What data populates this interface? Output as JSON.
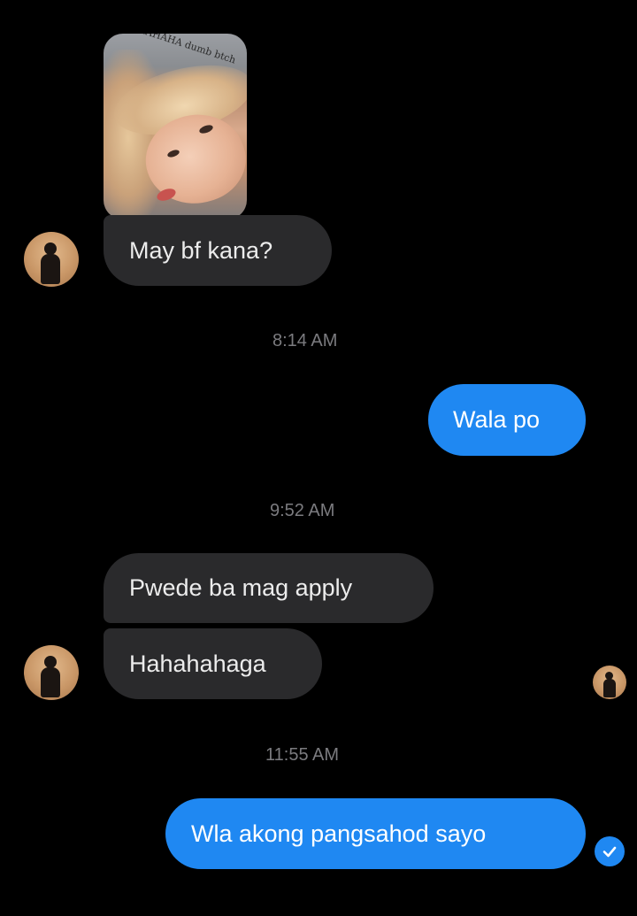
{
  "photo": {
    "caption": "HAHAHA dumb btch"
  },
  "messages": [
    {
      "id": "m1",
      "text": "May bf kana?"
    },
    {
      "id": "m2",
      "text": "Wala po"
    },
    {
      "id": "m3",
      "text": "Pwede ba mag apply"
    },
    {
      "id": "m4",
      "text": "Hahahahaga"
    },
    {
      "id": "m5",
      "text": "Wla akong pangsahod sayo"
    }
  ],
  "timestamps": [
    "8:14 AM",
    "9:52 AM",
    "11:55 AM"
  ],
  "icons": {
    "avatar": "contact-avatar",
    "seen": "seen-avatar",
    "delivered": "check-circle-icon"
  },
  "colors": {
    "incoming_bubble": "#2a2a2c",
    "outgoing_bubble": "#1f88f2",
    "timestamp": "#7b7b7f",
    "background": "#000000"
  }
}
